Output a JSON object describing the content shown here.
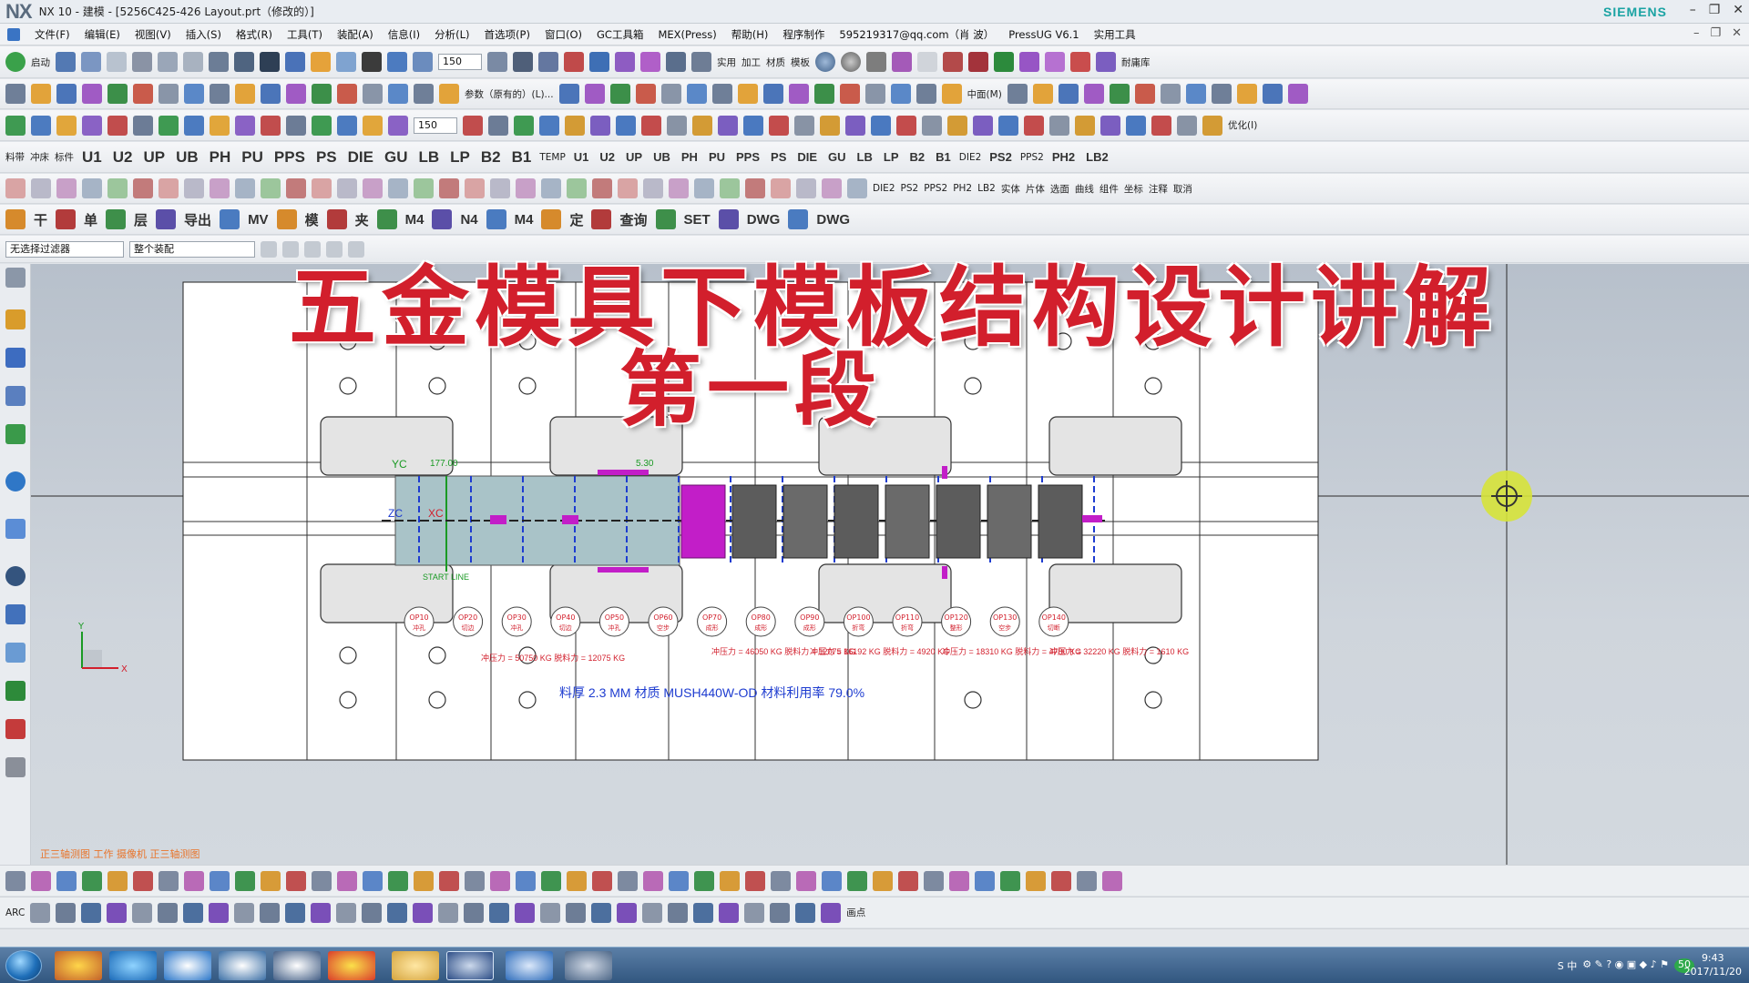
{
  "window": {
    "logo": "NX",
    "title": "NX 10 - 建模 - [5256C425-426 Layout.prt（修改的）]",
    "brand": "SIEMENS"
  },
  "menu": [
    "文件(F)",
    "编辑(E)",
    "视图(V)",
    "插入(S)",
    "格式(R)",
    "工具(T)",
    "装配(A)",
    "信息(I)",
    "分析(L)",
    "首选项(P)",
    "窗口(O)",
    "GC工具箱",
    "MEX(Press)",
    "帮助(H)",
    "程序制作",
    "595219317@qq.com（肖 波）",
    "PressUG V6.1",
    "实用工具"
  ],
  "toolbar1": {
    "start_label": "启动",
    "zoom_value": "150",
    "right_label": "耐庸库",
    "labels": [
      "实用",
      "加工",
      "材质",
      "模板"
    ]
  },
  "toolbar2": {
    "params_label": "参数（原有的）(L)...",
    "middle_label": "中面(M)"
  },
  "toolbar3": {
    "zoom_value": "150",
    "optimize_label": "优化(I)"
  },
  "toolbar4": {
    "items": [
      "料带",
      "冲床",
      "标件",
      "U1",
      "U2",
      "UP",
      "UB",
      "PH",
      "PU",
      "PPS",
      "PS",
      "DIE",
      "GU",
      "LB",
      "LP",
      "B2",
      "B1",
      "TEMP",
      "U1",
      "U2",
      "UP",
      "UB",
      "PH",
      "PU",
      "PPS",
      "PS",
      "DIE",
      "GU",
      "LB",
      "LP",
      "B2",
      "B1",
      "DIE2",
      "PS2",
      "PPS2",
      "PH2",
      "LB2"
    ]
  },
  "toolbar5": {
    "right_items": [
      "DIE2",
      "PS2",
      "PPS2",
      "PH2",
      "LB2",
      "实体",
      "片体",
      "选面",
      "曲线",
      "组件",
      "坐标",
      "注释",
      "取消"
    ]
  },
  "toolbar6": {
    "items": [
      "干",
      "单",
      "层",
      "导出",
      "MV",
      "模",
      "夹",
      "M4",
      "N4",
      "M4",
      "定",
      "查询",
      "SET",
      "DWG",
      "DWG"
    ]
  },
  "filter": {
    "filter_label": "无选择过滤器",
    "scope_label": "整个装配"
  },
  "overlay": {
    "title": "五金模具下模板结构设计讲解",
    "subtitle": "第一段"
  },
  "drawing": {
    "start_line": "START LINE",
    "dim_top": "177.00",
    "dim_side": "5.30",
    "ops": [
      "OP10",
      "OP20",
      "OP30",
      "OP40",
      "OP50",
      "OP60",
      "OP70",
      "OP80",
      "OP90",
      "OP100",
      "OP110",
      "OP120",
      "OP130",
      "OP140"
    ],
    "op_subs": [
      "冲孔",
      "切边",
      "冲孔",
      "切边",
      "冲孔",
      "空步",
      "成形",
      "成形",
      "成形",
      "折弯",
      "折弯",
      "整形",
      "空步",
      "切断"
    ],
    "force_notes": [
      "冲压力 = 50750 KG  脱料力 = 12075 KG",
      "冲压力 = 46050 KG  脱料力 = 12075 KG",
      "冲压力 = 16192 KG  脱料力 = 4920 KG",
      "冲压力 = 18310 KG  脱料力 = 4780 KG",
      "冲压力 = 32220 KG  脱料力 = 1610 KG"
    ],
    "material_note": "料厚 2.3 MM 材质 MUSH440W-OD  材料利用率 79.0%",
    "axis_xc": "XC",
    "axis_yc": "YC",
    "axis_zc": "ZC"
  },
  "triad": {
    "x": "X",
    "y": "Y"
  },
  "status": "正三轴测图 工作 摄像机 正三轴测图",
  "bottombar": {
    "arc_label": "ARC",
    "point_label": "画点"
  },
  "taskbar": {
    "tray_text": "S 中",
    "clock_time": "9:43",
    "clock_date": "2017/11/20",
    "badge": "50"
  },
  "colors": {
    "accent_red": "#d21f2c",
    "plate_blue": "#1e3cd0",
    "magenta": "#c21ec8",
    "brand_teal": "#1aa3a3"
  }
}
